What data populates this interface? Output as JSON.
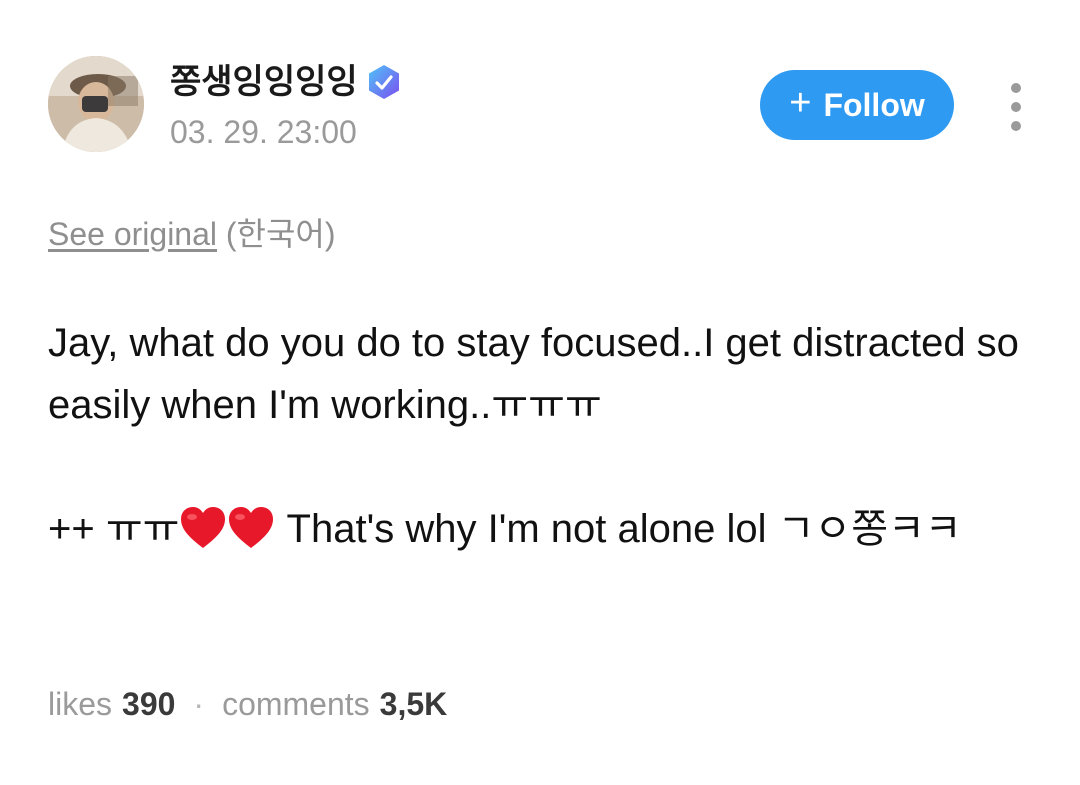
{
  "author": {
    "name": "쫑생잉잉잉잉",
    "timestamp": "03. 29. 23:00",
    "verified_icon": "verified-badge-icon"
  },
  "actions": {
    "follow_plus": "+",
    "follow_label": "Follow",
    "more_icon": "more-vertical-icon"
  },
  "translation": {
    "see_original": "See original",
    "language": "(한국어)"
  },
  "post": {
    "line1": "Jay, what do you do to stay focused..I get distracted so easily when I'm working..ㅠㅠㅠ",
    "line2_prefix": "++ ㅠㅠ",
    "heart_icon": "red-heart-icon",
    "line2_suffix": " That's why I'm not alone lol ㄱㅇ쫑ㅋㅋ"
  },
  "stats": {
    "likes_label": "likes",
    "likes_value": "390",
    "separator": "·",
    "comments_label": "comments",
    "comments_value": "3,5K"
  },
  "colors": {
    "follow_bg": "#2f9af1",
    "muted_text": "#9a9a9a",
    "heart": "#e8182b"
  }
}
